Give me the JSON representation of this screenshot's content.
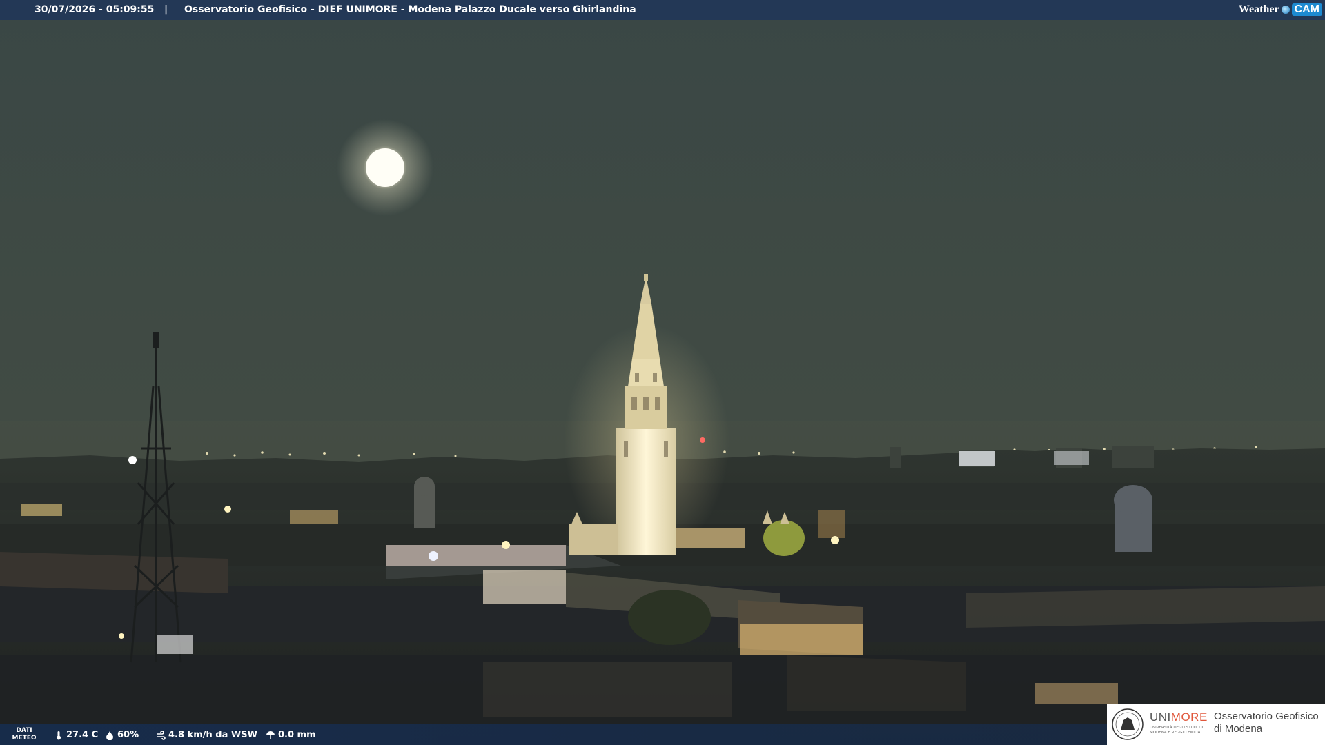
{
  "header": {
    "timestamp": "30/07/2026 - 05:09:55",
    "separator": "|",
    "title": "Osservatorio Geofisico - DIEF UNIMORE - Modena Palazzo Ducale verso Ghirlandina",
    "logo_weather": "Weather",
    "logo_cam": "CAM"
  },
  "weather": {
    "label": "DATI METEO",
    "temperature": "27.4 C",
    "humidity": "60%",
    "wind": "4.8 km/h da WSW",
    "rain": "0.0 mm",
    "icons": [
      "thermometer-icon",
      "humidity-drop-icon",
      "wind-icon",
      "rain-gauge-icon"
    ]
  },
  "org_logo": {
    "brand_plain": "UNI",
    "brand_accent": "MORE",
    "brand_sub": "Università degli studi di Modena e Reggio Emilia",
    "name": "Osservatorio Geofisico di Modena"
  },
  "colors": {
    "sky": "#3b4843",
    "bar": "#233856",
    "accent_red": "#e0573b",
    "wc_blue": "#1d8ad1",
    "lit_tower": "#f2e9c8"
  }
}
